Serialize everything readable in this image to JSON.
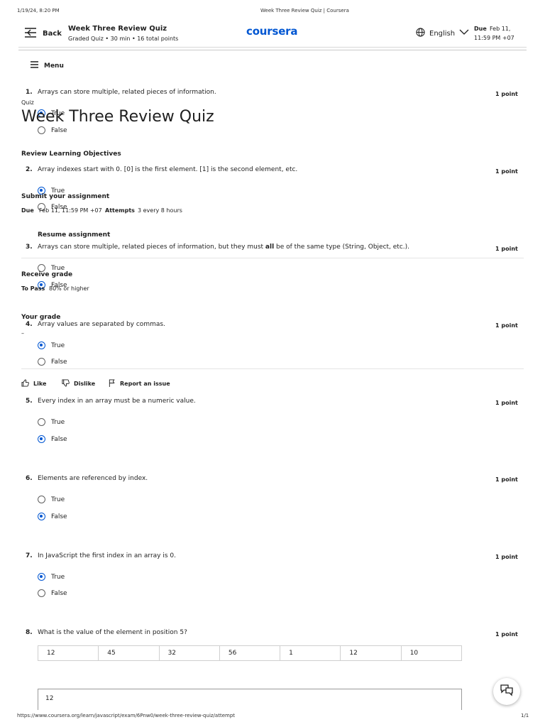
{
  "print": {
    "datetime": "1/19/24, 8:20 PM",
    "doc_title": "Week Three Review Quiz | Coursera",
    "url": "https://www.coursera.org/learn/javascript/exam/6Pnw0/week-three-review-quiz/attempt",
    "page": "1/1"
  },
  "header": {
    "back_label": "Back",
    "title": "Week Three Review Quiz",
    "subtitle": "Graded Quiz • 30 min • 16 total points",
    "logo": "coursera",
    "language": "English",
    "due_label": "Due",
    "due_value_line1": "Feb 11,",
    "due_value_line2": "11:59 PM +07"
  },
  "menu_label": "Menu",
  "overlay": {
    "quiz_kicker": "Quiz",
    "quiz_title": "Week Three Review Quiz",
    "objectives": "Review Learning Objectives",
    "submit_heading": "Submit your assignment",
    "due_label": "Due",
    "due_value": "Feb 11, 11:59 PM +07",
    "attempts_label": "Attempts",
    "attempts_value": "3 every 8 hours",
    "resume": "Resume assignment",
    "receive_grade": "Receive grade",
    "to_pass_label": "To Pass",
    "to_pass_value": "80% or higher",
    "your_grade": "Your grade",
    "grade_value": "–"
  },
  "feedback": {
    "like": "Like",
    "dislike": "Dislike",
    "report": "Report an issue"
  },
  "questions": [
    {
      "num": "1.",
      "text": "Arrays can store multiple, related pieces of information.",
      "points": "1 point",
      "options": [
        "True",
        "False"
      ],
      "selected": 0
    },
    {
      "num": "2.",
      "text": "Array indexes start with 0. [0] is the first element. [1] is the second element, etc.",
      "points": "1 point",
      "options": [
        "True",
        "False"
      ],
      "selected": 0
    },
    {
      "num": "3.",
      "text_before": "Arrays can store multiple, related pieces of information, but they must ",
      "text_bold": "all",
      "text_after": " be of the same type (String, Object, etc.).",
      "points": "1 point",
      "options": [
        "True",
        "False"
      ],
      "selected": 1
    },
    {
      "num": "4.",
      "text": "Array values are separated by commas.",
      "points": "1 point",
      "options": [
        "True",
        "False"
      ],
      "selected": 0
    },
    {
      "num": "5.",
      "text": "Every index in an array must be a numeric value.",
      "points": "1 point",
      "options": [
        "True",
        "False"
      ],
      "selected": 1
    },
    {
      "num": "6.",
      "text": "Elements are referenced by index.",
      "points": "1 point",
      "options": [
        "True",
        "False"
      ],
      "selected": 1
    },
    {
      "num": "7.",
      "text": "In JavaScript the first index in an array is 0.",
      "points": "1 point",
      "options": [
        "True",
        "False"
      ],
      "selected": 0
    },
    {
      "num": "8.",
      "text": "What is the value of the element in position 5?",
      "points": "1 point",
      "array": [
        "12",
        "45",
        "32",
        "56",
        "1",
        "12",
        "10"
      ],
      "answer": "12"
    }
  ]
}
